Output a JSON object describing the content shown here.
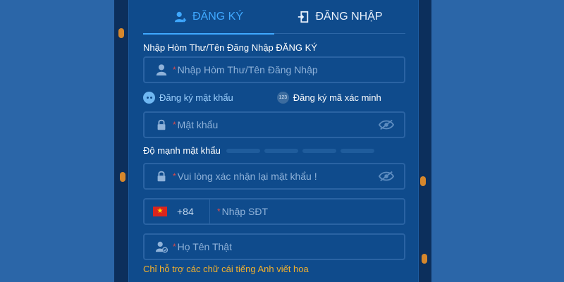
{
  "tabs": {
    "register": "ĐĂNG KÝ",
    "login": "ĐĂNG NHẬP"
  },
  "form": {
    "account_label": "Nhập Hòm Thư/Tên Đăng Nhập ĐĂNG KÝ",
    "account_placeholder": "Nhập Hòm Thư/Tên Đăng Nhập",
    "required_mark": "*",
    "mode_password": "Đăng ký mật khẩu",
    "mode_code": "Đăng ký mã xác minh",
    "code_icon_text": "123",
    "password_placeholder": "Mật khẩu",
    "strength_label": "Độ mạnh mật khẩu",
    "strength_level": 0,
    "confirm_placeholder": "Vui lòng xác nhận lại mật khẩu !",
    "country_code": "+84",
    "phone_placeholder": "Nhập SĐT",
    "realname_placeholder": "Họ Tên Thật",
    "realname_hint": "Chỉ hỗ trợ các chữ cái tiếng Anh viết hoa"
  },
  "colors": {
    "accent": "#3fa8ff",
    "panel": "#0f4b8c",
    "background": "#2b66a8",
    "hint": "#f2b02c",
    "required": "#e04a4a"
  },
  "icons": {
    "register_tab": "user-plus-icon",
    "login_tab": "login-door-icon",
    "account": "user-icon",
    "password": "lock-icon",
    "visibility": "eye-off-icon",
    "flag": "vietnam-flag-icon",
    "realname": "user-check-icon"
  }
}
